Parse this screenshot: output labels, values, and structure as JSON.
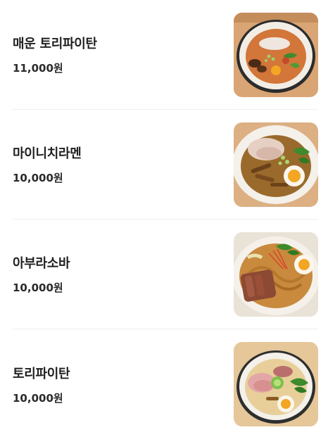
{
  "menu": {
    "items": [
      {
        "name": "매운 토리파이탄",
        "price": "11,000원",
        "image": "spicy-tori-paitan-bowl"
      },
      {
        "name": "마이니치라멘",
        "price": "10,000원",
        "image": "mainichi-ramen-bowl"
      },
      {
        "name": "아부라소바",
        "price": "10,000원",
        "image": "abura-soba-bowl"
      },
      {
        "name": "토리파이탄",
        "price": "10,000원",
        "image": "tori-paitan-bowl"
      }
    ]
  },
  "colors": {
    "wood": "#d9a574",
    "bowl_rim": "#f2eee6",
    "spicy_broth": "#d2763a",
    "shoyu_broth": "#9a6a2c",
    "abura_noodles": "#c98a3e",
    "white_broth": "#e8cf9a",
    "egg_yolk": "#f2a623",
    "greens": "#3f8a2c"
  }
}
